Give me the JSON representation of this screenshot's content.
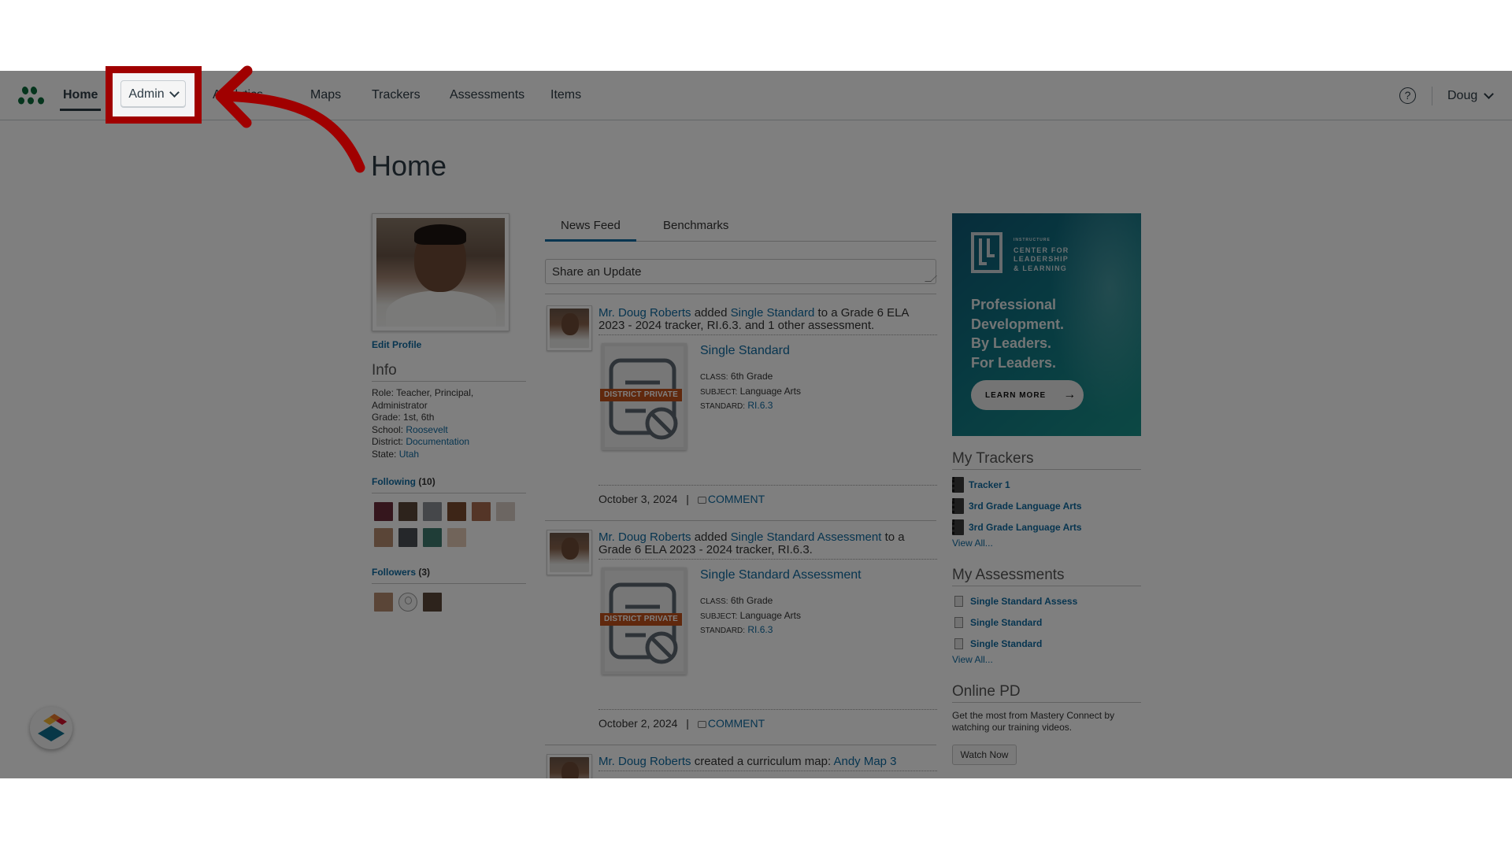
{
  "nav": {
    "items": [
      {
        "label": "Home",
        "active": true
      },
      {
        "label": "Admin"
      },
      {
        "label": "Analytics"
      },
      {
        "label": "Maps"
      },
      {
        "label": "Trackers"
      },
      {
        "label": "Assessments"
      },
      {
        "label": "Items"
      }
    ],
    "help_icon": "?",
    "user_label": "Doug"
  },
  "page": {
    "title": "Home"
  },
  "profile": {
    "edit_label": "Edit Profile",
    "info_heading": "Info",
    "role_label": "Role:",
    "role_value": "Teacher, Principal, Administrator",
    "grade_label": "Grade:",
    "grade_value": "1st, 6th",
    "school_label": "School:",
    "school_value": "Roosevelt",
    "district_label": "District:",
    "district_value": "Documentation",
    "state_label": "State:",
    "state_value": "Utah",
    "following_label": "Following",
    "following_count": "(10)",
    "followers_label": "Followers",
    "followers_count": "(3)"
  },
  "feed": {
    "tabs": [
      "News Feed",
      "Benchmarks"
    ],
    "active_tab": "News Feed",
    "share_placeholder": "Share an Update",
    "items": [
      {
        "actor": "Mr. Doug Roberts",
        "verb": "added",
        "object": "Single Standard",
        "rest": "to a Grade 6 ELA 2023 - 2024 tracker, RI.6.3. and 1 other assessment.",
        "card": {
          "badge": "DISTRICT PRIVATE",
          "title": "Single Standard",
          "class_label": "CLASS:",
          "class_value": "6th Grade",
          "subject_label": "SUBJECT:",
          "subject_value": "Language Arts",
          "standard_label": "STANDARD:",
          "standard_value": "RI.6.3"
        },
        "date": "October 3, 2024",
        "comment_label": "COMMENT"
      },
      {
        "actor": "Mr. Doug Roberts",
        "verb": "added",
        "object": "Single Standard Assessment",
        "rest": "to a Grade 6 ELA 2023 - 2024 tracker, RI.6.3.",
        "card": {
          "badge": "DISTRICT PRIVATE",
          "title": "Single Standard Assessment",
          "class_label": "CLASS:",
          "class_value": "6th Grade",
          "subject_label": "SUBJECT:",
          "subject_value": "Language Arts",
          "standard_label": "STANDARD:",
          "standard_value": "RI.6.3"
        },
        "date": "October 2, 2024",
        "comment_label": "COMMENT"
      },
      {
        "actor": "Mr. Doug Roberts",
        "verb": "created a curriculum map:",
        "object": "Andy Map 3"
      }
    ],
    "separator": "|"
  },
  "sidebar": {
    "ad": {
      "org_small": "INSTRUCTURE",
      "org_line1": "CENTER FOR",
      "org_line2": "LEADERSHIP",
      "org_line3": "& LEARNING",
      "headline_1": "Professional",
      "headline_2": "Development.",
      "headline_3": "By Leaders.",
      "headline_4": "For Leaders.",
      "cta": "LEARN MORE",
      "cta_icon": "→"
    },
    "trackers_heading": "My Trackers",
    "trackers": [
      "Tracker 1",
      "3rd Grade Language Arts",
      "3rd Grade Language Arts"
    ],
    "assessments_heading": "My Assessments",
    "assessments": [
      "Single Standard Assess",
      "Single Standard",
      "Single Standard"
    ],
    "view_all": "View All...",
    "pd_heading": "Online PD",
    "pd_text": "Get the most from Mastery Connect by watching our training videos.",
    "pd_button": "Watch Now"
  },
  "colors": {
    "link": "#0f6aa1",
    "brand_green": "#0b6b3a",
    "annotation_red": "#a00000",
    "badge_orange": "#c0501b"
  }
}
